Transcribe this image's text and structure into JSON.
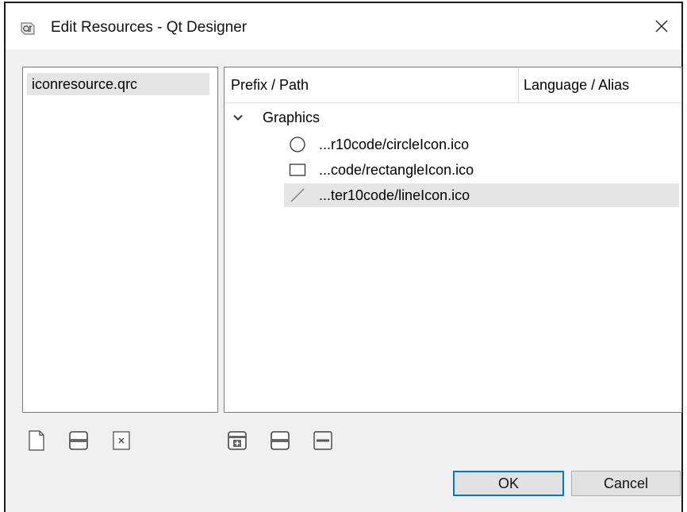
{
  "window": {
    "title": "Edit Resources - Qt Designer"
  },
  "file_list": {
    "items": [
      {
        "label": "iconresource.qrc"
      }
    ]
  },
  "tree": {
    "columns": [
      "Prefix / Path",
      "Language / Alias"
    ],
    "prefix": {
      "label": "Graphics",
      "expanded": true
    },
    "files": [
      {
        "label": "...r10code/circleIcon.ico",
        "icon": "circle-icon",
        "selected": false
      },
      {
        "label": "...code/rectangleIcon.ico",
        "icon": "rectangle-icon",
        "selected": false
      },
      {
        "label": "...ter10code/lineIcon.ico",
        "icon": "line-icon",
        "selected": true
      }
    ]
  },
  "file_toolbar": {
    "icons": [
      "new-file-icon",
      "open-file-icon",
      "remove-file-icon"
    ]
  },
  "tree_toolbar": {
    "icons": [
      "add-prefix-icon",
      "add-files-icon",
      "remove-icon"
    ]
  },
  "buttons": {
    "ok": "OK",
    "cancel": "Cancel"
  },
  "colors": {
    "selection": "#e5e5e5",
    "default_button_border": "#0078d7"
  }
}
